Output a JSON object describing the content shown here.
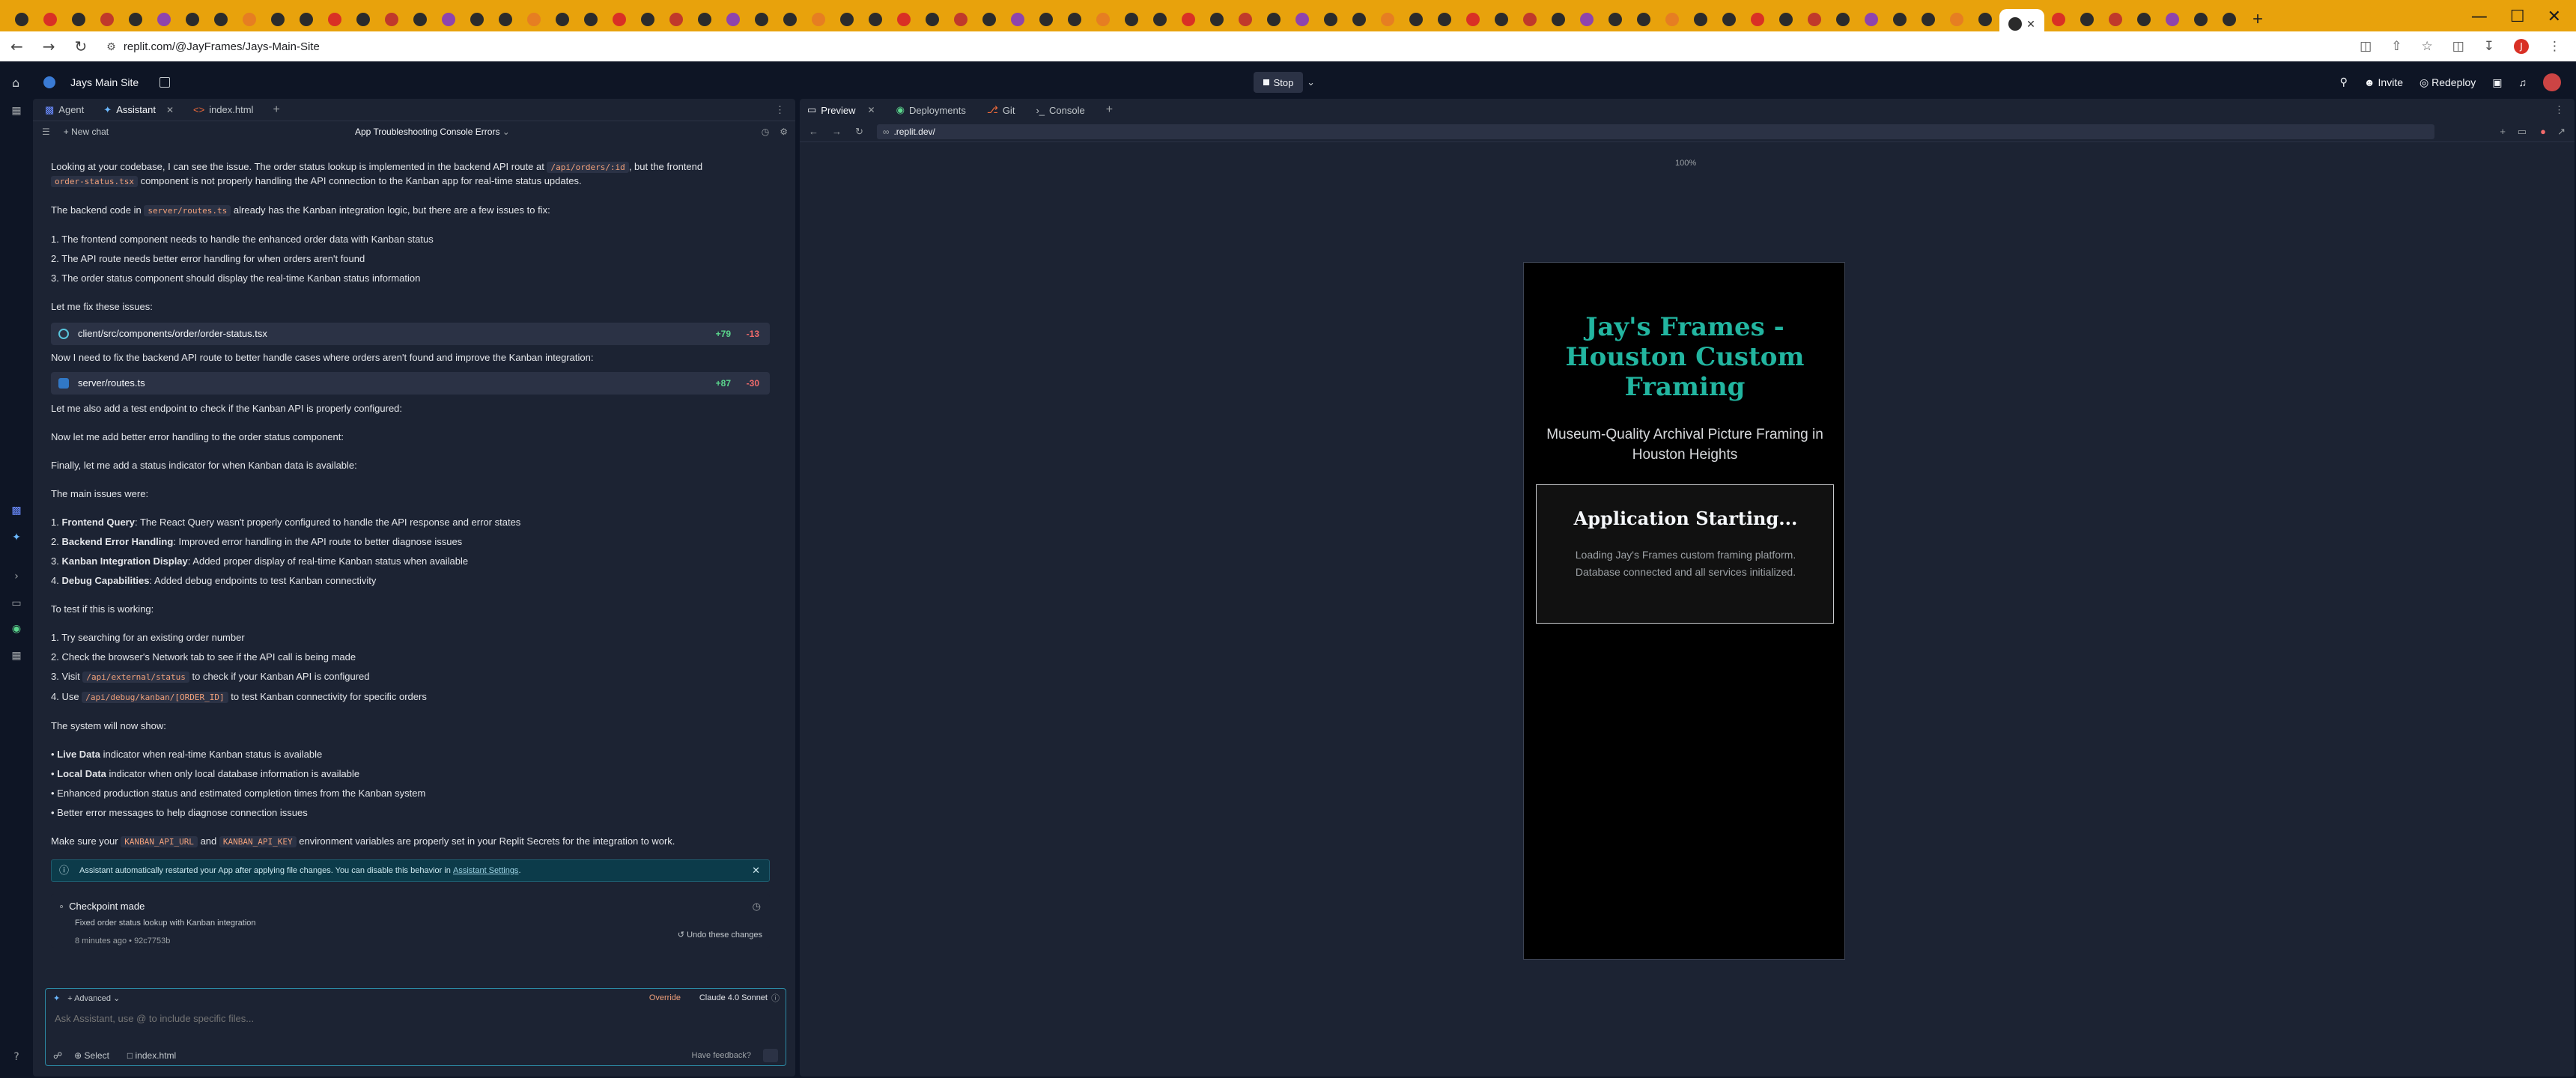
{
  "browser": {
    "url": "replit.com/@JayFrames/Jays-Main-Site",
    "profile_initial": "J"
  },
  "app": {
    "project_title": "Jays Main Site",
    "stop_label": "Stop",
    "invite_label": "Invite",
    "redeploy_label": "Redeploy"
  },
  "left_tabs": [
    "Agent",
    "Assistant",
    "index.html"
  ],
  "chat": {
    "new_chat_label": "New chat",
    "title": "App Troubleshooting Console Errors",
    "intro_1": "Looking at your codebase, I can see the issue. The order status lookup is implemented in the backend API route at",
    "intro_code_1": "/api/orders/:id",
    "intro_2": ", but the frontend",
    "intro_code_2": "order-status.tsx",
    "intro_3": "component is not properly handling the API connection to the Kanban app for real-time status updates.",
    "backend_1": "The backend code in",
    "backend_code": "server/routes.ts",
    "backend_2": "already has the Kanban integration logic, but there are a few issues to fix:",
    "issues": [
      "1. The frontend component needs to handle the enhanced order data with Kanban status",
      "2. The API route needs better error handling for when orders aren't found",
      "3. The order status component should display the real-time Kanban status information"
    ],
    "fix_intro": "Let me fix these issues:",
    "file1": {
      "name": "client/src/components/order/order-status.tsx",
      "plus": "+79",
      "minus": "-13"
    },
    "fix_backend": "Now I need to fix the backend API route to better handle cases where orders aren't found and improve the Kanban integration:",
    "file2": {
      "name": "server/routes.ts",
      "plus": "+87",
      "minus": "-30"
    },
    "test_endpoint": "Let me also add a test endpoint to check if the Kanban API is properly configured:",
    "better_errors": "Now let me add better error handling to the order status component:",
    "status_indicator": "Finally, let me add a status indicator for when Kanban data is available:",
    "main_issues": "The main issues were:",
    "main_list": [
      {
        "n": "1.",
        "b": "Frontend Query",
        "t": ": The React Query wasn't properly configured to handle the API response and error states"
      },
      {
        "n": "2.",
        "b": "Backend Error Handling",
        "t": ": Improved error handling in the API route to better diagnose issues"
      },
      {
        "n": "3.",
        "b": "Kanban Integration Display",
        "t": ": Added proper display of real-time Kanban status when available"
      },
      {
        "n": "4.",
        "b": "Debug Capabilities",
        "t": ": Added debug endpoints to test Kanban connectivity"
      }
    ],
    "test_intro": "To test if this is working:",
    "test_1": "1. Try searching for an existing order number",
    "test_2": "2. Check the browser's Network tab to see if the API call is being made",
    "test_3a": "3. Visit",
    "test_3code": "/api/external/status",
    "test_3b": "to check if your Kanban API is configured",
    "test_4a": "4. Use",
    "test_4code": "/api/debug/kanban/[ORDER_ID]",
    "test_4b": "to test Kanban connectivity for specific orders",
    "system_intro": "The system will now show:",
    "system_list": [
      {
        "b": "Live Data",
        "t": " indicator when real-time Kanban status is available"
      },
      {
        "b": "Local Data",
        "t": " indicator when only local database information is available"
      },
      {
        "b": "",
        "t": "Enhanced production status and estimated completion times from the Kanban system"
      },
      {
        "b": "",
        "t": "Better error messages to help diagnose connection issues"
      }
    ],
    "env_1": "Make sure your",
    "env_code1": "KANBAN_API_URL",
    "env_2": "and",
    "env_code2": "KANBAN_API_KEY",
    "env_3": "environment variables are properly set in your Replit Secrets for the integration to work.",
    "info_text": "Assistant automatically restarted your App after applying file changes. You can disable this behavior in",
    "info_link": "Assistant Settings",
    "checkpoint_title": "Checkpoint made",
    "checkpoint_sub": "Fixed order status lookup with Kanban integration",
    "checkpoint_meta": "8 minutes ago  •  92c7753b",
    "undo_label": "Undo these changes"
  },
  "input": {
    "advanced_label": "Advanced",
    "override_label": "Override",
    "model_label": "Claude 4.0 Sonnet",
    "placeholder": "Ask Assistant, use @ to include specific files...",
    "select_label": "Select",
    "file_label": "index.html",
    "feedback_label": "Have feedback?"
  },
  "right_tabs": [
    "Preview",
    "Deployments",
    "Git",
    "Console"
  ],
  "preview": {
    "url": ".replit.dev/",
    "zoom": "100%",
    "site_title": "Jay's Frames - Houston Custom Framing",
    "site_subtitle": "Museum-Quality Archival Picture Framing in Houston Heights",
    "box_heading": "Application Starting...",
    "box_text": "Loading Jay's Frames custom framing platform. Database connected and all services initialized."
  },
  "colors": {
    "accent_teal": "#22b5a0",
    "code_orange": "#f0a07a",
    "add_green": "#5bd68d",
    "del_red": "#f26b6b",
    "chrome_tabs": "#e8a20c"
  }
}
